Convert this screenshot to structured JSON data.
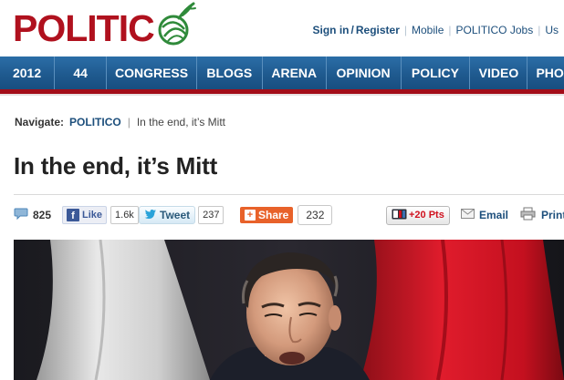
{
  "header": {
    "logo_text": "POLITIC",
    "top_links": {
      "signin": "Sign in",
      "slash": "/",
      "register": "Register",
      "mobile": "Mobile",
      "jobs": "POLITICO Jobs",
      "us": "Us"
    }
  },
  "nav": {
    "items": [
      "2012",
      "44",
      "CONGRESS",
      "BLOGS",
      "ARENA",
      "OPINION",
      "POLICY",
      "VIDEO",
      "PHO"
    ]
  },
  "breadcrumb": {
    "label": "Navigate:",
    "home": "POLITICO",
    "current": "In the end, it’s Mitt"
  },
  "article": {
    "headline": "In the end, it’s Mitt"
  },
  "social": {
    "comments": "825",
    "like_label": "Like",
    "like_count": "1.6k",
    "tweet_label": "Tweet",
    "tweet_count": "237",
    "share_label": "Share",
    "share_count": "232",
    "points_label": "+20 Pts",
    "email_label": "Email",
    "print_label": "Print"
  },
  "icons": {
    "comment": "speech-bubble-icon",
    "facebook": "facebook-f-icon",
    "twitter": "twitter-bird-icon",
    "share": "plus-icon",
    "points": "badge-icon",
    "email": "envelope-icon",
    "print": "printer-icon",
    "logo": "onion-logo-icon"
  },
  "colors": {
    "brand_red": "#b0111e",
    "nav_blue": "#1f5a8f",
    "link_blue": "#1d4f7c",
    "share_orange": "#e8622a"
  }
}
